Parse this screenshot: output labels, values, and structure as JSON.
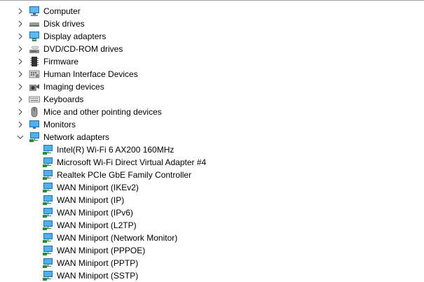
{
  "tree": {
    "categories": [
      {
        "label": "Computer",
        "icon": "computer-icon",
        "expanded": false
      },
      {
        "label": "Disk drives",
        "icon": "disk-drive-icon",
        "expanded": false
      },
      {
        "label": "Display adapters",
        "icon": "display-adapter-icon",
        "expanded": false
      },
      {
        "label": "DVD/CD-ROM drives",
        "icon": "dvd-drive-icon",
        "expanded": false
      },
      {
        "label": "Firmware",
        "icon": "firmware-chip-icon",
        "expanded": false
      },
      {
        "label": "Human Interface Devices",
        "icon": "hid-keyboard-icon",
        "expanded": false
      },
      {
        "label": "Imaging devices",
        "icon": "camera-icon",
        "expanded": false
      },
      {
        "label": "Keyboards",
        "icon": "keyboard-icon",
        "expanded": false
      },
      {
        "label": "Mice and other pointing devices",
        "icon": "mouse-icon",
        "expanded": false
      },
      {
        "label": "Monitors",
        "icon": "monitor-icon",
        "expanded": false
      },
      {
        "label": "Network adapters",
        "icon": "network-adapter-icon",
        "expanded": true,
        "children": [
          {
            "label": "Intel(R) Wi-Fi 6 AX200 160MHz"
          },
          {
            "label": "Microsoft Wi-Fi Direct Virtual Adapter #4"
          },
          {
            "label": "Realtek PCIe GbE Family Controller"
          },
          {
            "label": "WAN Miniport (IKEv2)"
          },
          {
            "label": "WAN Miniport (IP)"
          },
          {
            "label": "WAN Miniport (IPv6)"
          },
          {
            "label": "WAN Miniport (L2TP)"
          },
          {
            "label": "WAN Miniport (Network Monitor)"
          },
          {
            "label": "WAN Miniport (PPPOE)"
          },
          {
            "label": "WAN Miniport (PPTP)"
          },
          {
            "label": "WAN Miniport (SSTP)"
          }
        ]
      }
    ]
  },
  "colors": {
    "chevron": "#555555",
    "screen_blue": "#2f9ae0",
    "screen_dark": "#1c6fb0",
    "device_grey": "#7a7a7a"
  }
}
